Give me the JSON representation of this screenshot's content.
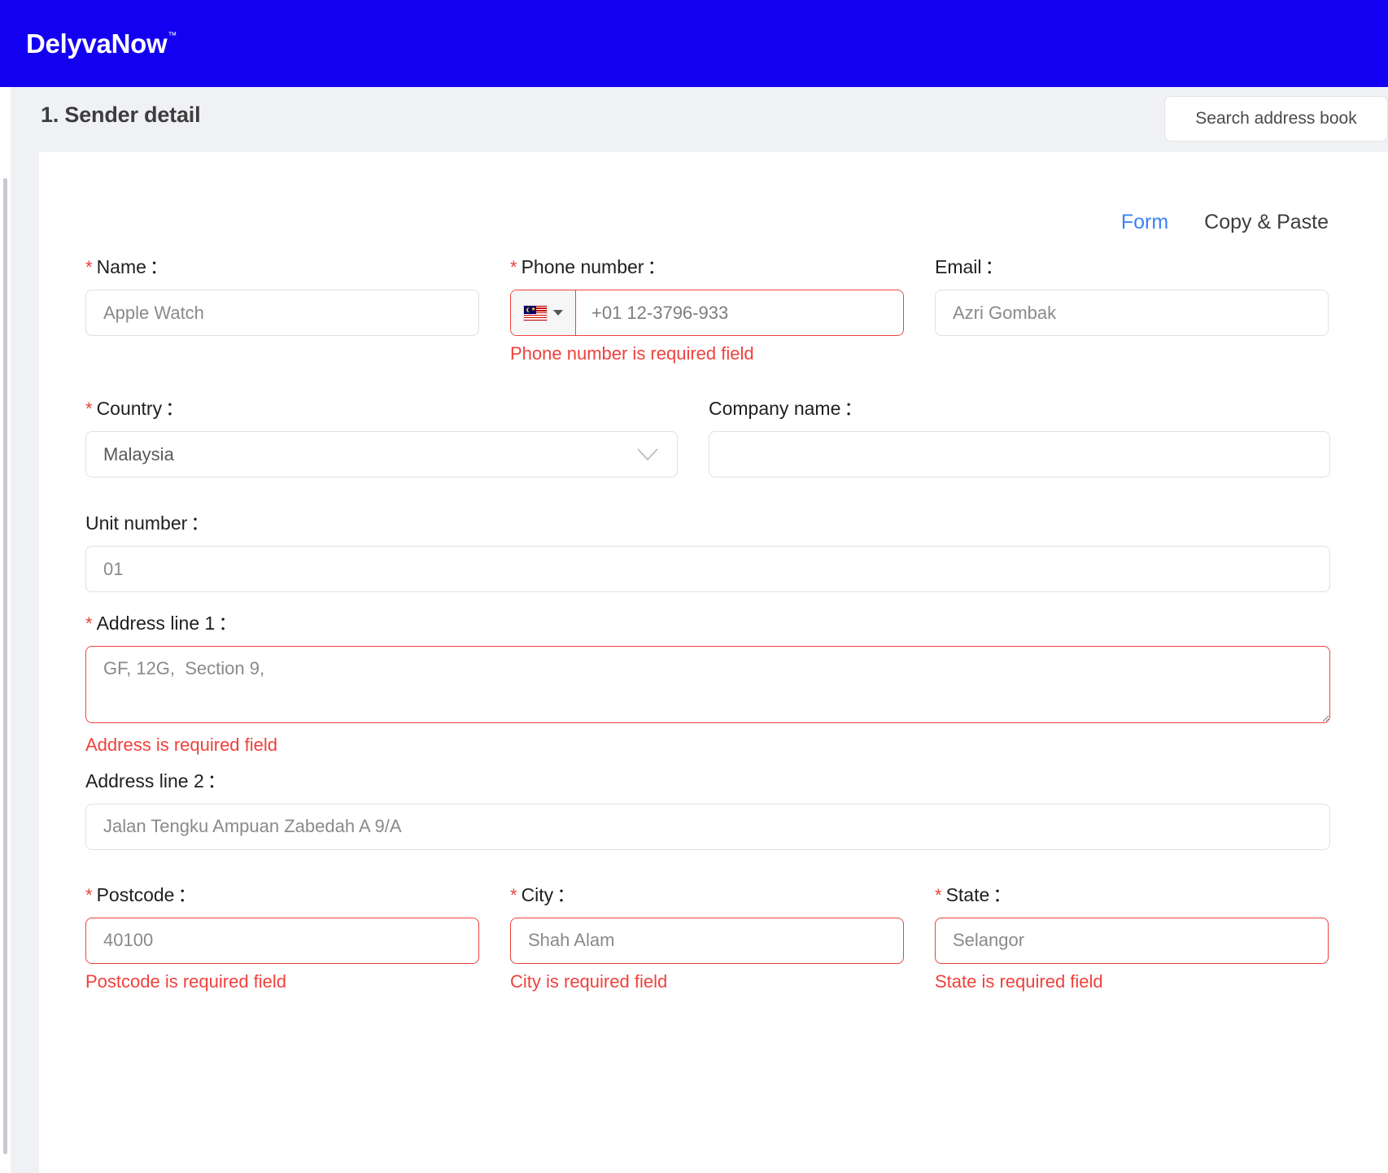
{
  "brand": {
    "logo_text": "DelyvaNow",
    "logo_tm": "™",
    "bar_color": "#1400f0"
  },
  "section": {
    "title": "1. Sender detail",
    "search_button_label": "Search address book"
  },
  "tabs": [
    {
      "label": "Form",
      "active": true
    },
    {
      "label": "Copy & Paste",
      "active": false
    }
  ],
  "colors": {
    "accent": "#1400f0",
    "tab_active": "#3b82f6",
    "error": "#f0413c",
    "required_star": "#e8413c"
  },
  "form": {
    "required_star": "*",
    "colon": "：",
    "name": {
      "label": "Name",
      "required": true,
      "value": "",
      "placeholder": "Apple Watch"
    },
    "phone": {
      "label": "Phone number",
      "required": true,
      "country_flag": "malaysia-flag-icon",
      "dropdown_icon": "caret-down-icon",
      "value": "",
      "placeholder": "+01 12-3796-933",
      "error": "Phone number is required field"
    },
    "email": {
      "label": "Email",
      "required": false,
      "value": "",
      "placeholder": "Azri Gombak"
    },
    "country": {
      "label": "Country",
      "required": true,
      "selected": "Malaysia",
      "chevron_icon": "chevron-down-icon"
    },
    "company": {
      "label": "Company name",
      "required": false,
      "value": "",
      "placeholder": ""
    },
    "unit_number": {
      "label": "Unit number",
      "required": false,
      "value": "",
      "placeholder": "01"
    },
    "address_line_1": {
      "label": "Address line 1",
      "required": true,
      "value": "",
      "placeholder": "GF, 12G,  Section 9,",
      "error": "Address is required field"
    },
    "address_line_2": {
      "label": "Address line 2",
      "required": false,
      "value": "",
      "placeholder": "Jalan Tengku Ampuan Zabedah A 9/A"
    },
    "postcode": {
      "label": "Postcode",
      "required": true,
      "value": "",
      "placeholder": "40100",
      "error": "Postcode is required field"
    },
    "city": {
      "label": "City",
      "required": true,
      "value": "",
      "placeholder": "Shah Alam",
      "error": "City is required field"
    },
    "state": {
      "label": "State",
      "required": true,
      "value": "",
      "placeholder": "Selangor",
      "error": "State is required field"
    }
  }
}
